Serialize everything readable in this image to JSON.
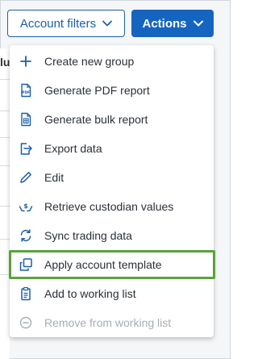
{
  "toolbar": {
    "filters_label": "Account filters",
    "actions_label": "Actions"
  },
  "background": {
    "column_header_fragment": "lu"
  },
  "menu": {
    "items": [
      {
        "label": "Create new group",
        "icon": "plus-icon"
      },
      {
        "label": "Generate PDF report",
        "icon": "pdf-file-icon"
      },
      {
        "label": "Generate bulk report",
        "icon": "bulk-file-icon"
      },
      {
        "label": "Export data",
        "icon": "export-icon"
      },
      {
        "label": "Edit",
        "icon": "pencil-icon"
      },
      {
        "label": "Retrieve custodian values",
        "icon": "hand-dollar-icon"
      },
      {
        "label": "Sync trading data",
        "icon": "sync-icon"
      },
      {
        "label": "Apply account template",
        "icon": "copy-template-icon"
      },
      {
        "label": "Add to working list",
        "icon": "clipboard-icon"
      },
      {
        "label": "Remove from working list",
        "icon": "minus-circle-icon"
      }
    ]
  },
  "colors": {
    "primary": "#1565c0",
    "icon_blue": "#1c5fa8",
    "highlight_border": "#5aa13d",
    "disabled_text": "#a7adb3"
  }
}
